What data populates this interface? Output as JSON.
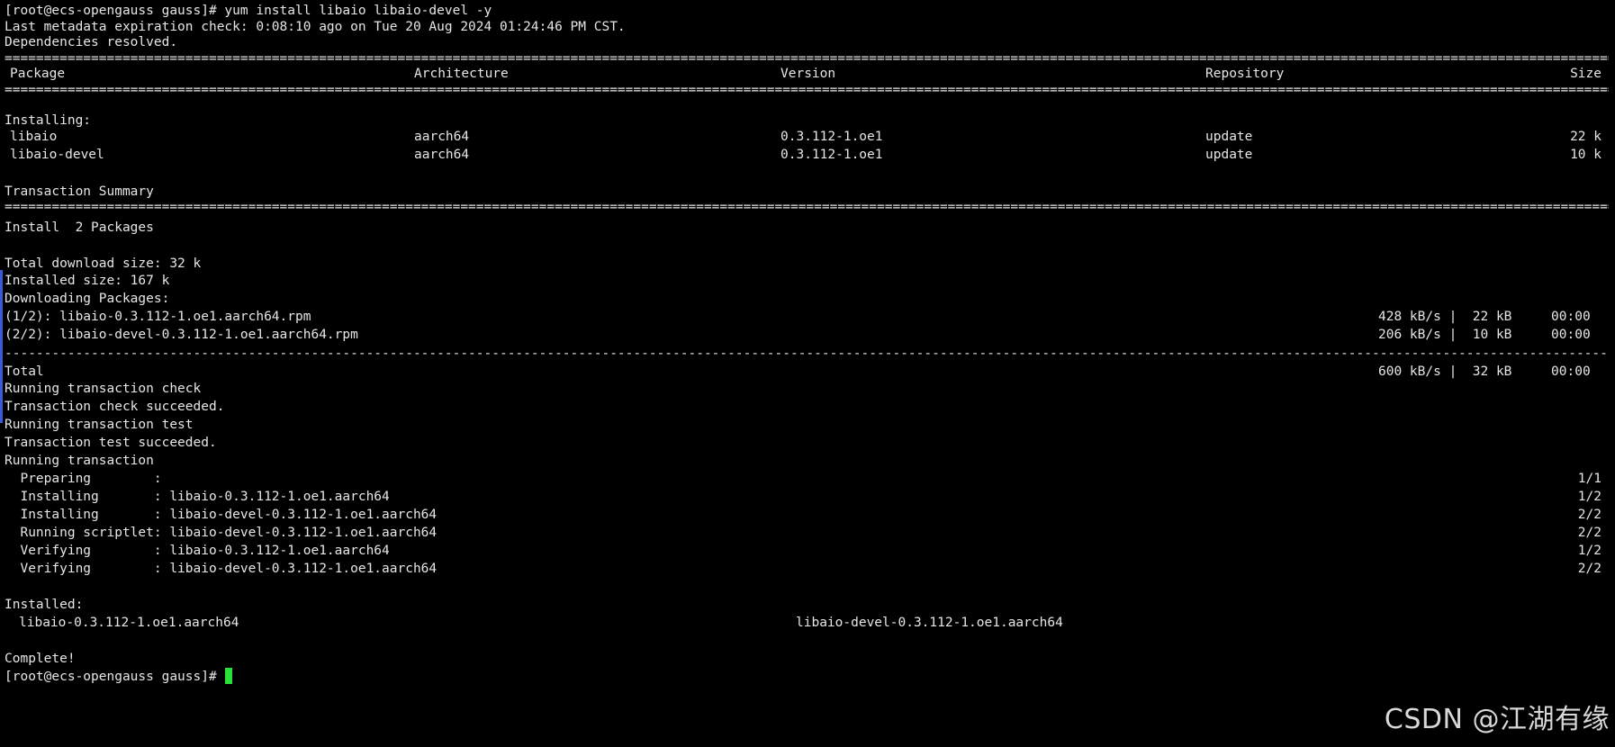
{
  "terminal": {
    "prompt_command": "[root@ecs-opengauss gauss]# yum install libaio libaio-devel -y",
    "metadata_line": "Last metadata expiration check: 0:08:10 ago on Tue 20 Aug 2024 01:24:46 PM CST.",
    "deps_resolved": "Dependencies resolved.",
    "table_header": {
      "package": "Package",
      "architecture": "Architecture",
      "version": "Version",
      "repository": "Repository",
      "size": "Size"
    },
    "installing_label": "Installing:",
    "packages": [
      {
        "name": "libaio",
        "arch": "aarch64",
        "version": "0.3.112-1.oe1",
        "repo": "update",
        "size": "22 k"
      },
      {
        "name": "libaio-devel",
        "arch": "aarch64",
        "version": "0.3.112-1.oe1",
        "repo": "update",
        "size": "10 k"
      }
    ],
    "transaction_summary": "Transaction Summary",
    "install_count": "Install  2 Packages",
    "total_download": "Total download size: 32 k",
    "installed_size": "Installed size: 167 k",
    "downloading": "Downloading Packages:",
    "downloads": [
      {
        "file": "(1/2): libaio-0.3.112-1.oe1.aarch64.rpm",
        "stats": "428 kB/s |  22 kB     00:00"
      },
      {
        "file": "(2/2): libaio-devel-0.3.112-1.oe1.aarch64.rpm",
        "stats": "206 kB/s |  10 kB     00:00"
      }
    ],
    "total": {
      "label": "Total",
      "stats": "600 kB/s |  32 kB     00:00"
    },
    "checks": [
      "Running transaction check",
      "Transaction check succeeded.",
      "Running transaction test",
      "Transaction test succeeded.",
      "Running transaction"
    ],
    "steps": [
      {
        "text": "  Preparing        :",
        "count": "1/1"
      },
      {
        "text": "  Installing       : libaio-0.3.112-1.oe1.aarch64",
        "count": "1/2"
      },
      {
        "text": "  Installing       : libaio-devel-0.3.112-1.oe1.aarch64",
        "count": "2/2"
      },
      {
        "text": "  Running scriptlet: libaio-devel-0.3.112-1.oe1.aarch64",
        "count": "2/2"
      },
      {
        "text": "  Verifying        : libaio-0.3.112-1.oe1.aarch64",
        "count": "1/2"
      },
      {
        "text": "  Verifying        : libaio-devel-0.3.112-1.oe1.aarch64",
        "count": "2/2"
      }
    ],
    "installed_label": "Installed:",
    "installed_items": [
      "libaio-0.3.112-1.oe1.aarch64",
      "libaio-devel-0.3.112-1.oe1.aarch64"
    ],
    "complete": "Complete!",
    "final_prompt": "[root@ecs-opengauss gauss]#",
    "cursor_color": "#27e03a"
  },
  "watermark": "CSDN @江湖有缘"
}
